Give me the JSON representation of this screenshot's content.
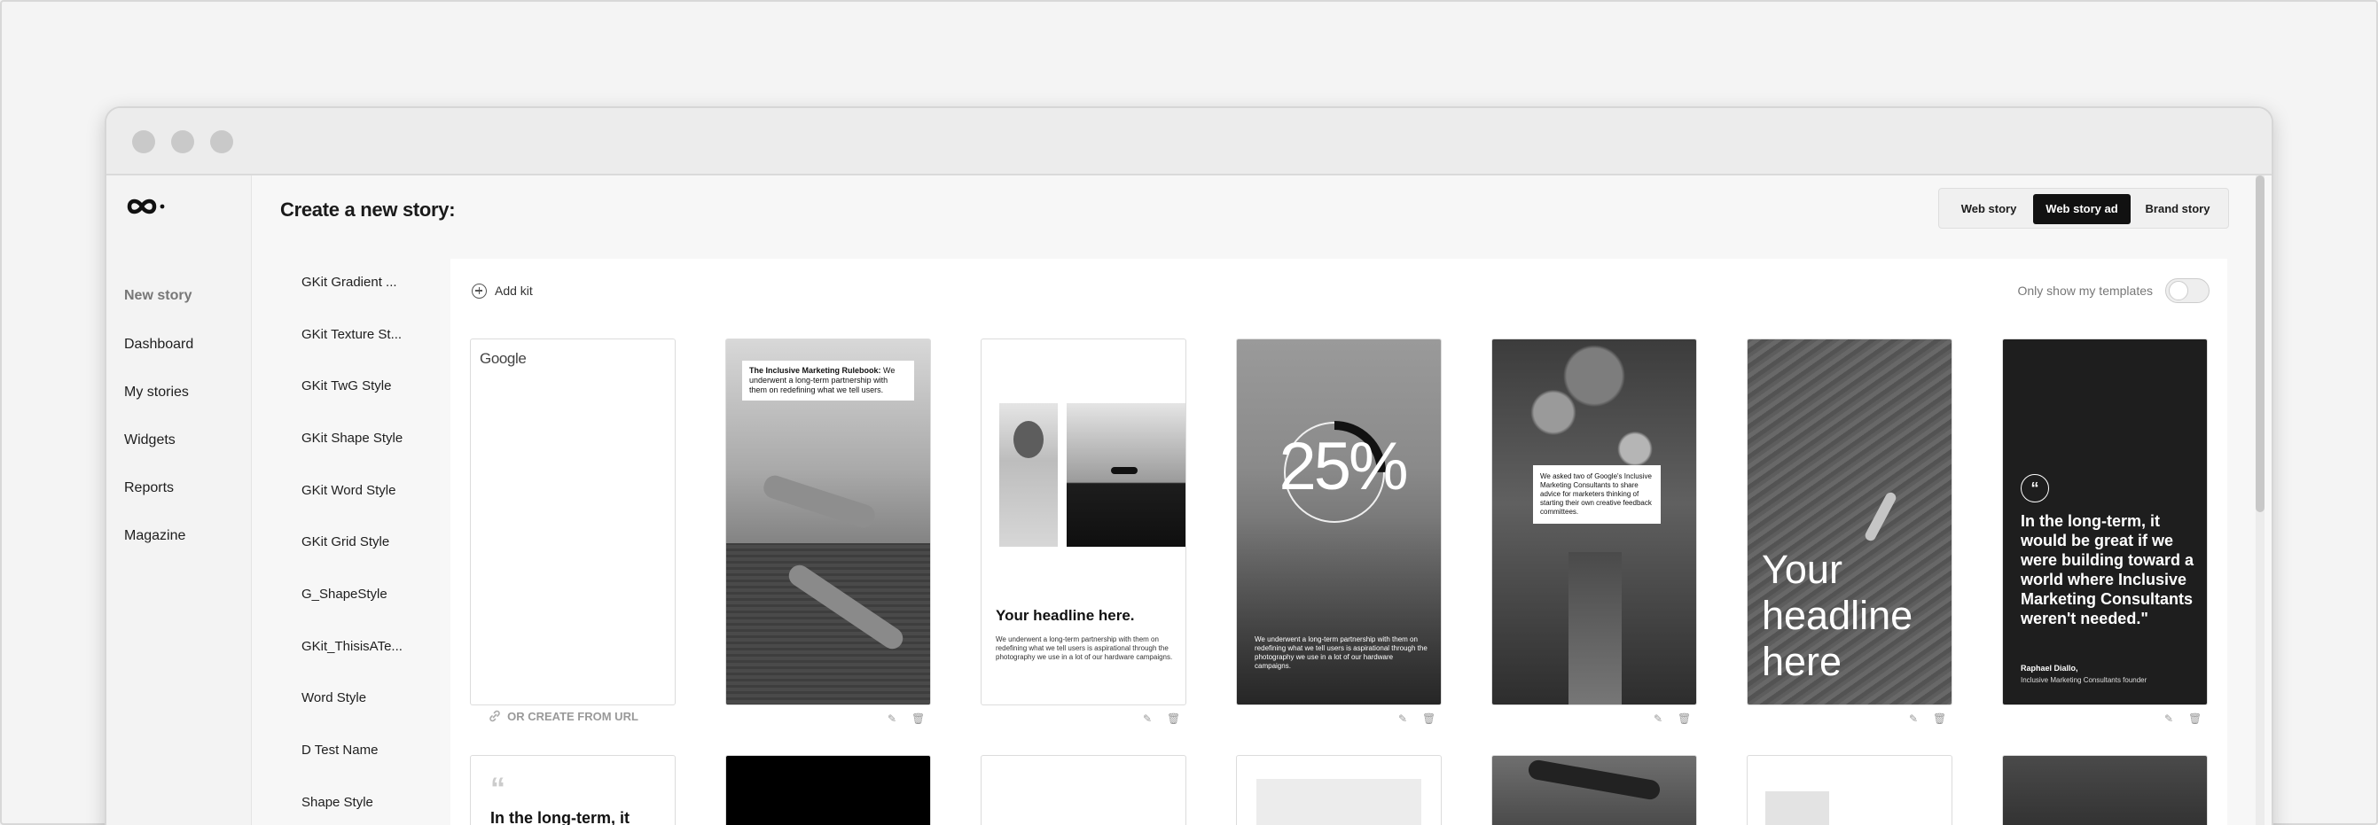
{
  "nav": {
    "items": [
      {
        "label": "New story"
      },
      {
        "label": "Dashboard"
      },
      {
        "label": "My stories"
      },
      {
        "label": "Widgets"
      },
      {
        "label": "Reports"
      },
      {
        "label": "Magazine"
      }
    ]
  },
  "kits": [
    "GKit Gradient ...",
    "GKit Texture St...",
    "GKit TwG Style",
    "GKit Shape Style",
    "GKit Word Style",
    "GKit Grid Style",
    "G_ShapeStyle",
    "GKit_ThisisATe...",
    "Word Style",
    "D Test Name",
    "Shape Style"
  ],
  "header": {
    "title": "Create a new story:",
    "story_types": [
      "Web story",
      "Web story ad",
      "Brand story"
    ],
    "active_story_type": "Web story ad"
  },
  "toolbar": {
    "add_kit_label": "Add kit",
    "only_mine_label": "Only show my templates",
    "only_mine_checked": false
  },
  "templates": {
    "blank_card_brand": "Google",
    "create_from_url_label": "OR CREATE FROM URL",
    "rulebook_title": "The Inclusive Marketing Rulebook:",
    "rulebook_body": "We underwent a long-term partnership with them on redefining what we tell users.",
    "headline": "Your headline here.",
    "headline_body": "We underwent a long-term partnership with them on redefining what we tell users is aspirational through the photography we use in a lot of our hardware campaigns.",
    "stat_value": "25%",
    "stat_progress": 0.25,
    "stat_body": "We underwent a long-term partnership with them on redefining what we tell users is aspirational through the photography we use in a lot of our hardware campaigns.",
    "forest_quote": "We asked two of Google's Inclusive Marketing Consultants to share advice for marketers thinking of starting their own creative feedback committees.",
    "water_headline": "Your headline here",
    "quote_text": "In the long-term, it would be great if we were building toward a world where Inclusive Marketing Consultants weren't needed.\"",
    "quote_author": "Raphael Diallo,",
    "quote_author_role": "Inclusive Marketing Consultants founder",
    "row2_quote": "In the long-term, it"
  }
}
